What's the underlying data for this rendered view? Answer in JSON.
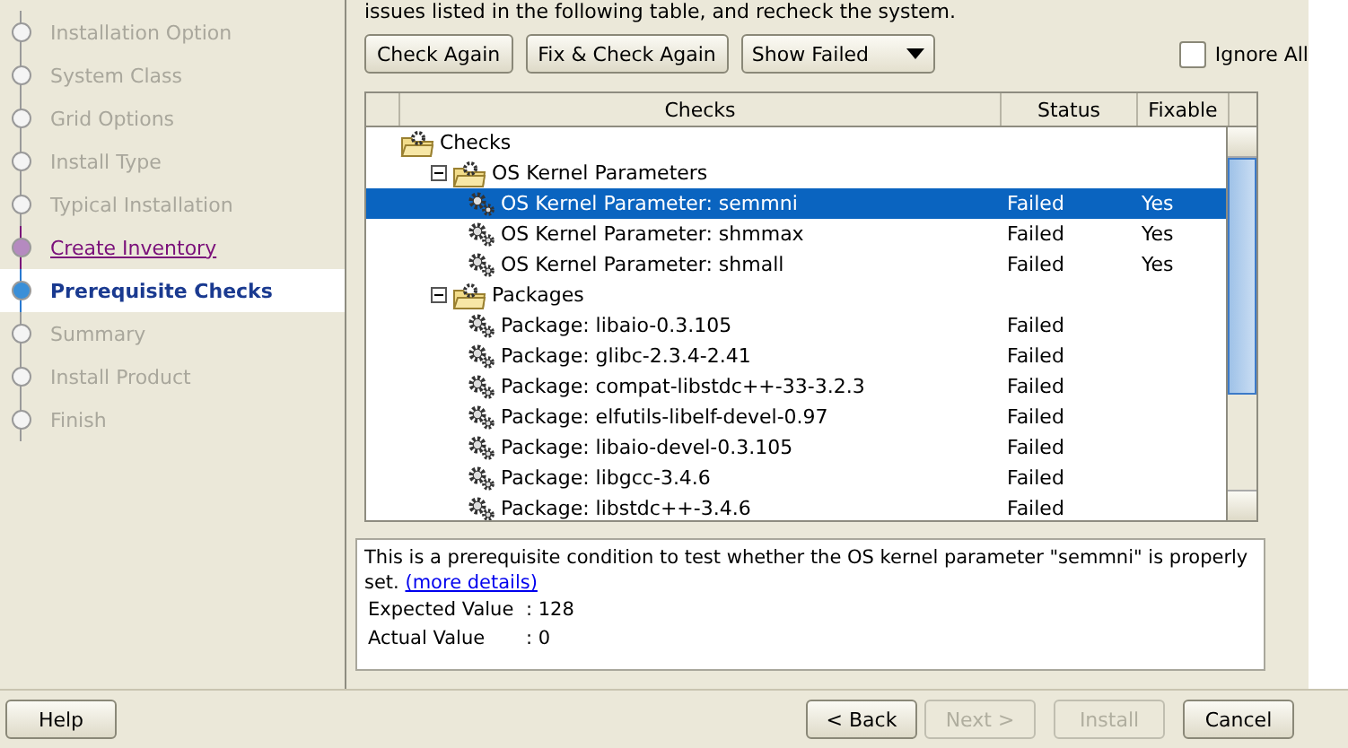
{
  "sidebar": {
    "items": [
      {
        "label": "Installation Option",
        "kind": "done",
        "selected": false
      },
      {
        "label": "System Class",
        "kind": "done",
        "selected": false
      },
      {
        "label": "Grid Options",
        "kind": "done",
        "selected": false
      },
      {
        "label": "Install Type",
        "kind": "done",
        "selected": false
      },
      {
        "label": "Typical Installation",
        "kind": "done",
        "selected": false
      },
      {
        "label": "Create Inventory",
        "kind": "link",
        "selected": false
      },
      {
        "label": "Prerequisite Checks",
        "kind": "current",
        "selected": true
      },
      {
        "label": "Summary",
        "kind": "todo",
        "selected": false
      },
      {
        "label": "Install Product",
        "kind": "todo",
        "selected": false
      },
      {
        "label": "Finish",
        "kind": "todo",
        "selected": false
      }
    ]
  },
  "instruction": "issues listed in the following table, and recheck the system.",
  "toolbar": {
    "buttons": [
      "Check Again",
      "Fix & Check Again"
    ],
    "filter": {
      "value": "Show Failed"
    },
    "ignore_all": {
      "label": "Ignore All",
      "checked": false
    }
  },
  "table": {
    "columns": [
      "Checks",
      "Status",
      "Fixable"
    ],
    "rows": [
      {
        "label": "Checks",
        "kind": "root",
        "selected": false,
        "children": [
          {
            "label": "OS Kernel Parameters",
            "kind": "group",
            "expanded": true,
            "selected": false,
            "children": [
              {
                "label": "OS Kernel Parameter: semmni",
                "kind": "check",
                "status": "Failed",
                "fixable": "Yes",
                "selected": true
              },
              {
                "label": "OS Kernel Parameter: shmmax",
                "kind": "check",
                "status": "Failed",
                "fixable": "Yes",
                "selected": false
              },
              {
                "label": "OS Kernel Parameter: shmall",
                "kind": "check",
                "status": "Failed",
                "fixable": "Yes",
                "selected": false
              }
            ]
          },
          {
            "label": "Packages",
            "kind": "group",
            "expanded": true,
            "selected": false,
            "children": [
              {
                "label": "Package: libaio-0.3.105",
                "kind": "check",
                "status": "Failed",
                "selected": false
              },
              {
                "label": "Package: glibc-2.3.4-2.41",
                "kind": "check",
                "status": "Failed",
                "selected": false
              },
              {
                "label": "Package: compat-libstdc++-33-3.2.3",
                "kind": "check",
                "status": "Failed",
                "selected": false
              },
              {
                "label": "Package: elfutils-libelf-devel-0.97",
                "kind": "check",
                "status": "Failed",
                "selected": false
              },
              {
                "label": "Package: libaio-devel-0.3.105",
                "kind": "check",
                "status": "Failed",
                "selected": false
              },
              {
                "label": "Package: libgcc-3.4.6",
                "kind": "check",
                "status": "Failed",
                "selected": false
              },
              {
                "label": "Package: libstdc++-3.4.6",
                "kind": "check",
                "status": "Failed",
                "selected": false
              }
            ]
          }
        ]
      }
    ]
  },
  "details": {
    "text": "This is a prerequisite condition to test whether the OS kernel parameter \"semmni\" is properly set.",
    "link": "(more details)",
    "values": [
      {
        "label": "Expected Value",
        "value": ": 128"
      },
      {
        "label": "Actual Value",
        "value": ": 0"
      }
    ]
  },
  "buttons": [
    {
      "label": "Help",
      "disabled": false
    },
    {
      "label": "< Back",
      "disabled": false
    },
    {
      "label": "Next >",
      "disabled": true
    },
    {
      "label": "Install",
      "disabled": true
    },
    {
      "label": "Cancel",
      "disabled": false
    }
  ]
}
